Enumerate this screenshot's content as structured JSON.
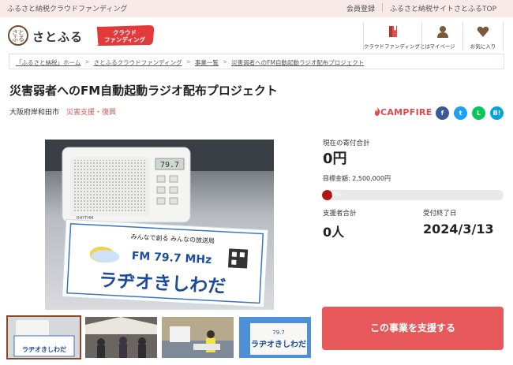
{
  "topbar": {
    "tagline": "ふるさと納税クラウドファンディング",
    "links": [
      "会員登録",
      "ふるさと納税サイトさとふるTOP"
    ]
  },
  "header": {
    "logo_text": "さとふる",
    "logo_mark": "さと\nふる",
    "badge_line1": "クラウド",
    "badge_line2": "ファンディング",
    "nav": [
      {
        "label": "クラウドファンディングとは",
        "icon": "book-icon"
      },
      {
        "label": "マイページ",
        "icon": "user-icon"
      },
      {
        "label": "お気に入り",
        "icon": "heart-icon"
      }
    ]
  },
  "breadcrumb": [
    "「ふるさと納税」ホーム",
    "さとふるクラウドファンディング",
    "事業一覧",
    "災害弱者へのFM自動起動ラジオ配布プロジェクト"
  ],
  "project": {
    "title": "災害弱者へのFM自動起動ラジオ配布プロジェクト",
    "location": "大阪府岸和田市",
    "category": "災害支援・復興",
    "platform": "CAMPFIRE"
  },
  "share": [
    {
      "name": "facebook-share-icon",
      "glyph": "f",
      "color": "#3b5998"
    },
    {
      "name": "twitter-share-icon",
      "glyph": "t",
      "color": "#1da1f2"
    },
    {
      "name": "line-share-icon",
      "glyph": "L",
      "color": "#06c755"
    },
    {
      "name": "hatena-share-icon",
      "glyph": "B!",
      "color": "#00a4de"
    }
  ],
  "stats": {
    "current_label": "現在の寄付合計",
    "current_value": "0円",
    "goal": "目標金額: 2,500,000円",
    "progress_text": "0%",
    "progress_fraction": 0,
    "supporters_label": "支援者合計",
    "supporters_value": "0人",
    "deadline_label": "受付終了日",
    "deadline_value": "2024/3/13"
  },
  "image_text": {
    "display": "79.7",
    "brand": "RHYTHM",
    "slogan": "みんなで創る みんなの放送局",
    "station": "FM 79.7 MHz",
    "name": "ラヂオきしわだ"
  },
  "support_button": "この事業を支援する"
}
